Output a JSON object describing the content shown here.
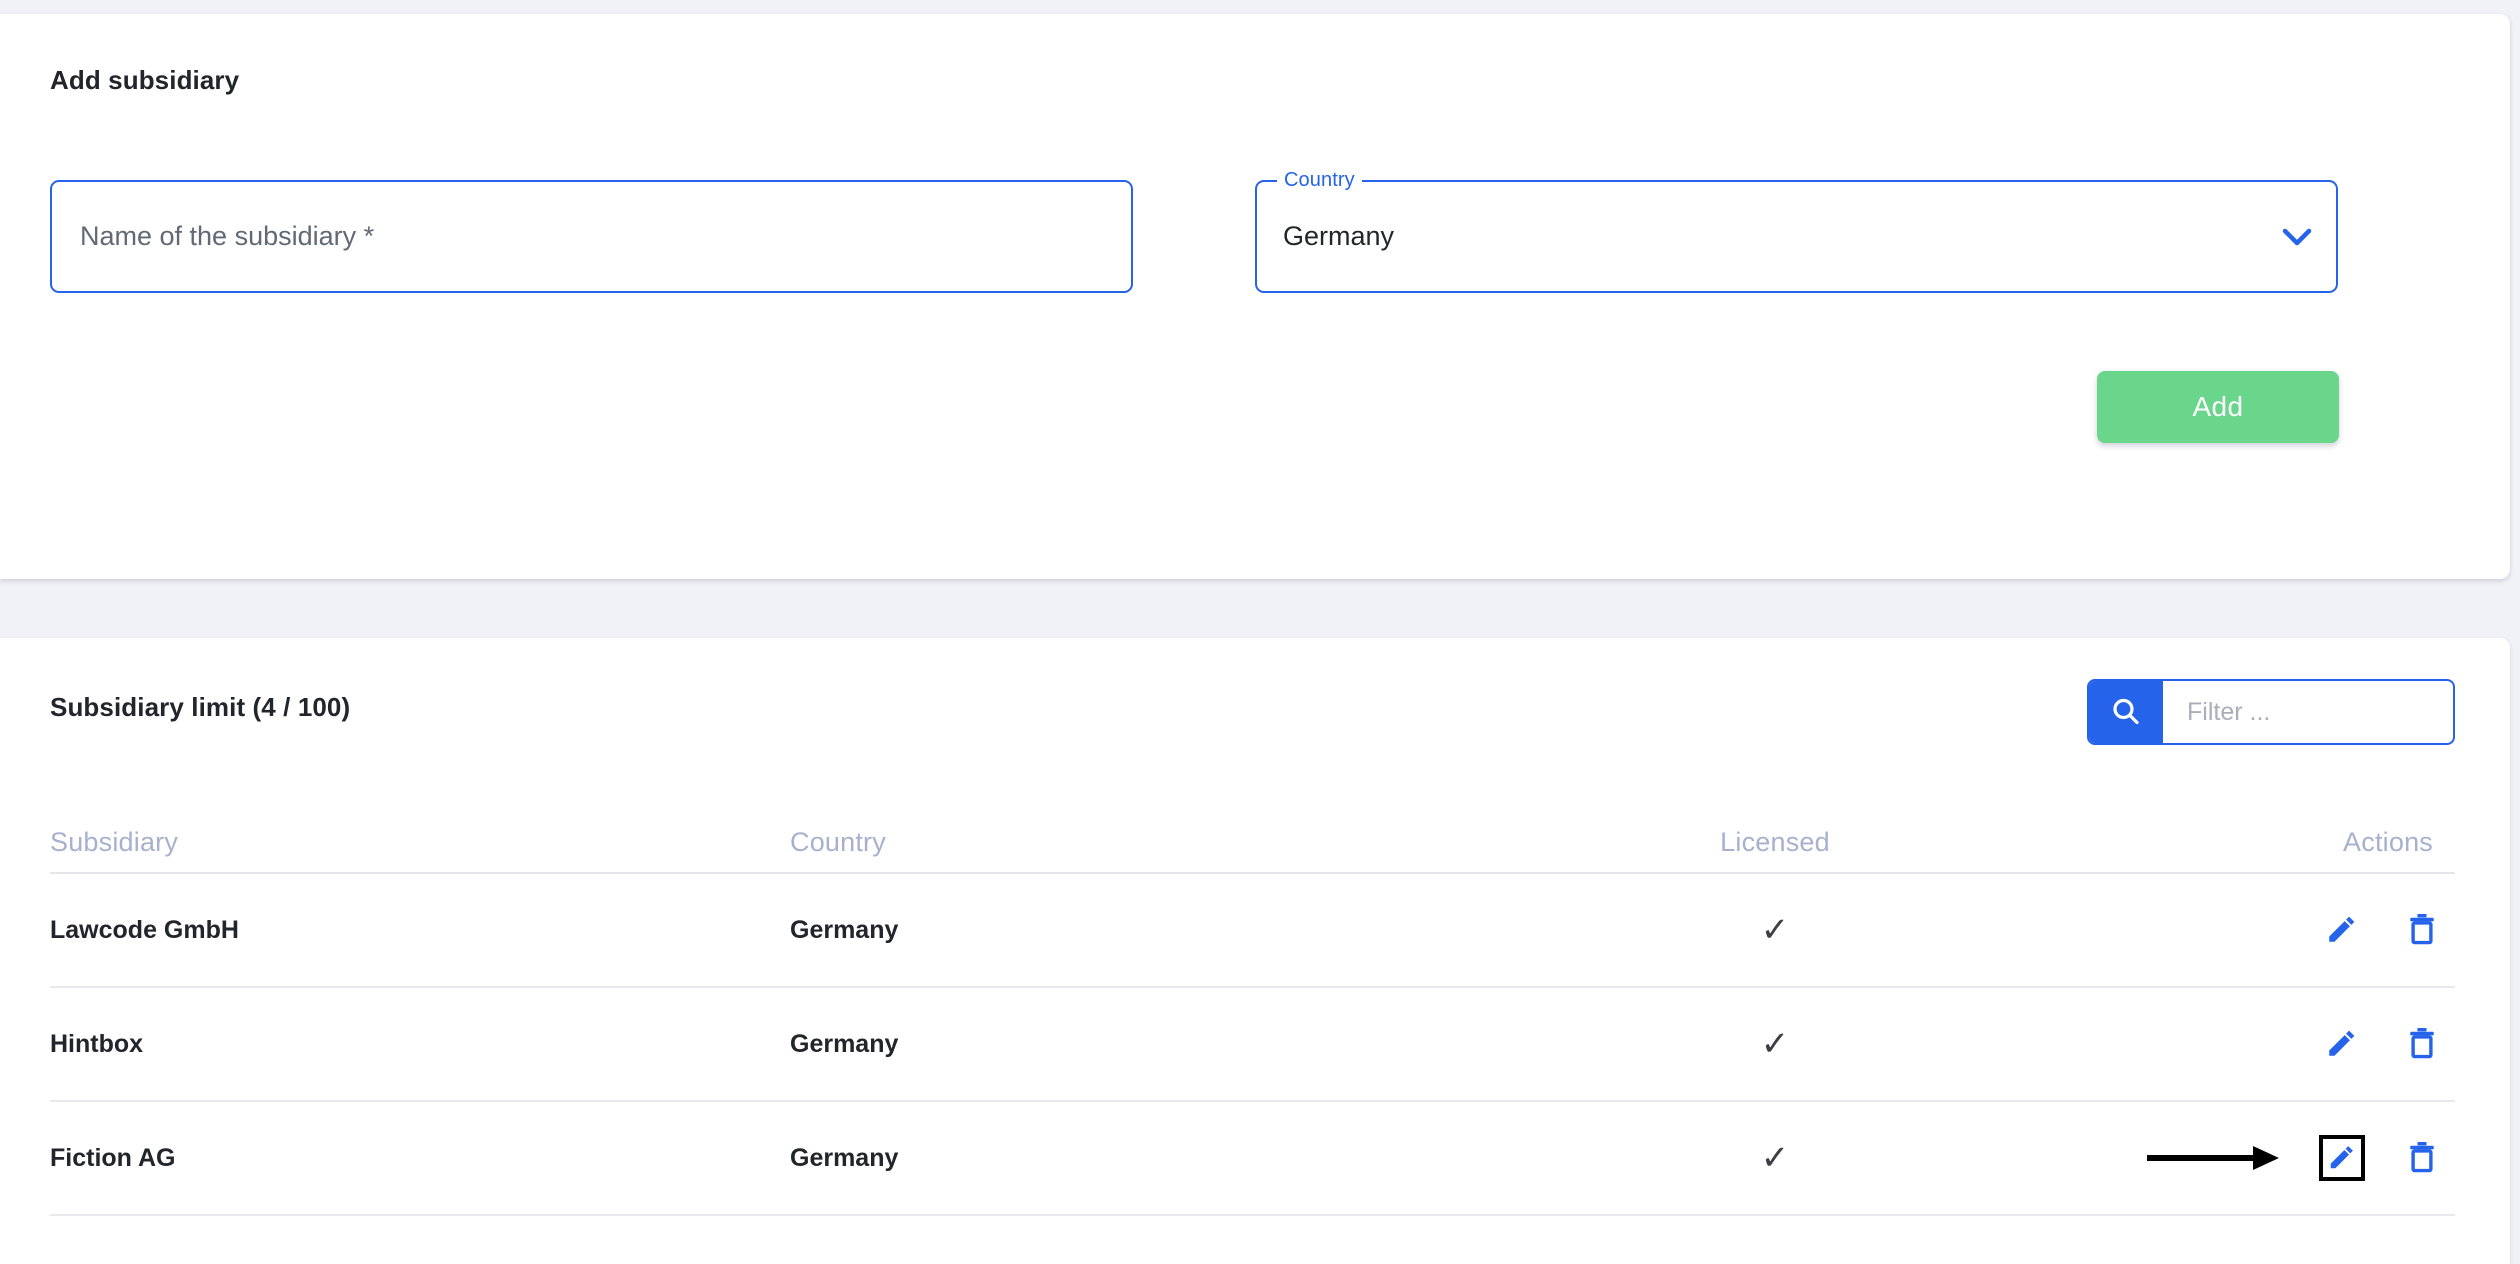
{
  "add_section": {
    "title": "Add subsidiary",
    "name_input": {
      "placeholder": "Name of the subsidiary *",
      "value": ""
    },
    "country_select": {
      "label": "Country",
      "selected": "Germany",
      "arrow_icon": "chevron-down-icon"
    },
    "add_button_label": "Add"
  },
  "list_section": {
    "limit_label": "Subsidiary limit (4 / 100)",
    "filter": {
      "placeholder": "Filter ...",
      "value": "",
      "search_icon": "search-icon"
    },
    "table": {
      "headers": [
        "Subsidiary",
        "Country",
        "Licensed",
        "Actions"
      ],
      "rows": [
        {
          "subsidiary": "Lawcode GmbH",
          "country": "Germany",
          "licensed": "✓",
          "edit_icon": "pencil-icon",
          "delete_icon": "trash-icon",
          "highlighted": false
        },
        {
          "subsidiary": "Hintbox",
          "country": "Germany",
          "licensed": "✓",
          "edit_icon": "pencil-icon",
          "delete_icon": "trash-icon",
          "highlighted": false
        },
        {
          "subsidiary": "Fiction AG",
          "country": "Germany",
          "licensed": "✓",
          "edit_icon": "pencil-icon",
          "delete_icon": "trash-icon",
          "highlighted": true
        }
      ]
    }
  },
  "colors": {
    "accent_blue": "#2563eb",
    "add_green": "#69d68b",
    "header_text": "#a7b1cf",
    "page_bg": "#f1f2f8",
    "annotation": "#000000"
  }
}
